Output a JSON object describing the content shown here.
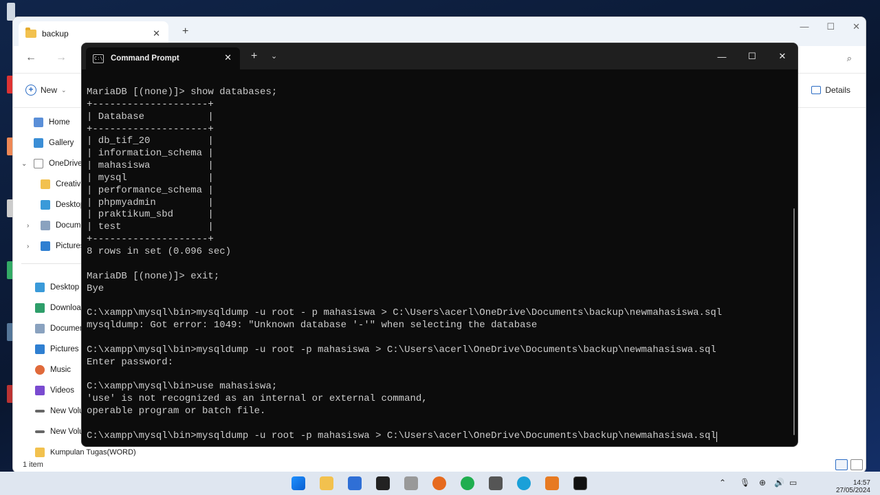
{
  "explorer": {
    "tab_title": "backup",
    "new_label": "New",
    "details_label": "Details",
    "status": "1 item",
    "sidebar": [
      {
        "label": "Home",
        "icon": "home-icon"
      },
      {
        "label": "Gallery",
        "icon": "gallery-icon"
      },
      {
        "label": "OneDrive",
        "icon": "onedrive-icon"
      },
      {
        "label": "Creative",
        "icon": "folder-icon"
      },
      {
        "label": "Desktop",
        "icon": "desktop-icon"
      },
      {
        "label": "Docume",
        "icon": "documents-icon"
      },
      {
        "label": "Pictures",
        "icon": "pictures-icon"
      },
      {
        "label": "Desktop",
        "icon": "desktop-icon"
      },
      {
        "label": "Download",
        "icon": "download-icon"
      },
      {
        "label": "Documen",
        "icon": "documents-icon"
      },
      {
        "label": "Pictures",
        "icon": "pictures-icon"
      },
      {
        "label": "Music",
        "icon": "music-icon"
      },
      {
        "label": "Videos",
        "icon": "videos-icon"
      },
      {
        "label": "New Volu",
        "icon": "drive-icon"
      },
      {
        "label": "New Volu",
        "icon": "drive-icon"
      },
      {
        "label": "Kumpulan Tugas(WORD)",
        "icon": "folder-icon"
      }
    ]
  },
  "cmd": {
    "tab_title": "Command Prompt",
    "lines": [
      "MariaDB [(none)]> show databases;",
      "+--------------------+",
      "| Database           |",
      "+--------------------+",
      "| db_tif_20          |",
      "| information_schema |",
      "| mahasiswa          |",
      "| mysql              |",
      "| performance_schema |",
      "| phpmyadmin         |",
      "| praktikum_sbd      |",
      "| test               |",
      "+--------------------+",
      "8 rows in set (0.096 sec)",
      "",
      "MariaDB [(none)]> exit;",
      "Bye",
      "",
      "C:\\xampp\\mysql\\bin>mysqldump -u root - p mahasiswa > C:\\Users\\acerl\\OneDrive\\Documents\\backup\\newmahasiswa.sql",
      "mysqldump: Got error: 1049: \"Unknown database '-'\" when selecting the database",
      "",
      "C:\\xampp\\mysql\\bin>mysqldump -u root -p mahasiswa > C:\\Users\\acerl\\OneDrive\\Documents\\backup\\newmahasiswa.sql",
      "Enter password:",
      "",
      "C:\\xampp\\mysql\\bin>use mahasiswa;",
      "'use' is not recognized as an internal or external command,",
      "operable program or batch file.",
      "",
      "C:\\xampp\\mysql\\bin>mysqldump -u root -p mahasiswa > C:\\Users\\acerl\\OneDrive\\Documents\\backup\\newmahasiswa.sql"
    ]
  },
  "taskbar": {
    "time": "14:57",
    "date": "27/05/2024"
  },
  "colors": {
    "console_bg": "#0c0c0c",
    "console_text": "#cccccc",
    "accent": "#2b6cc4"
  }
}
